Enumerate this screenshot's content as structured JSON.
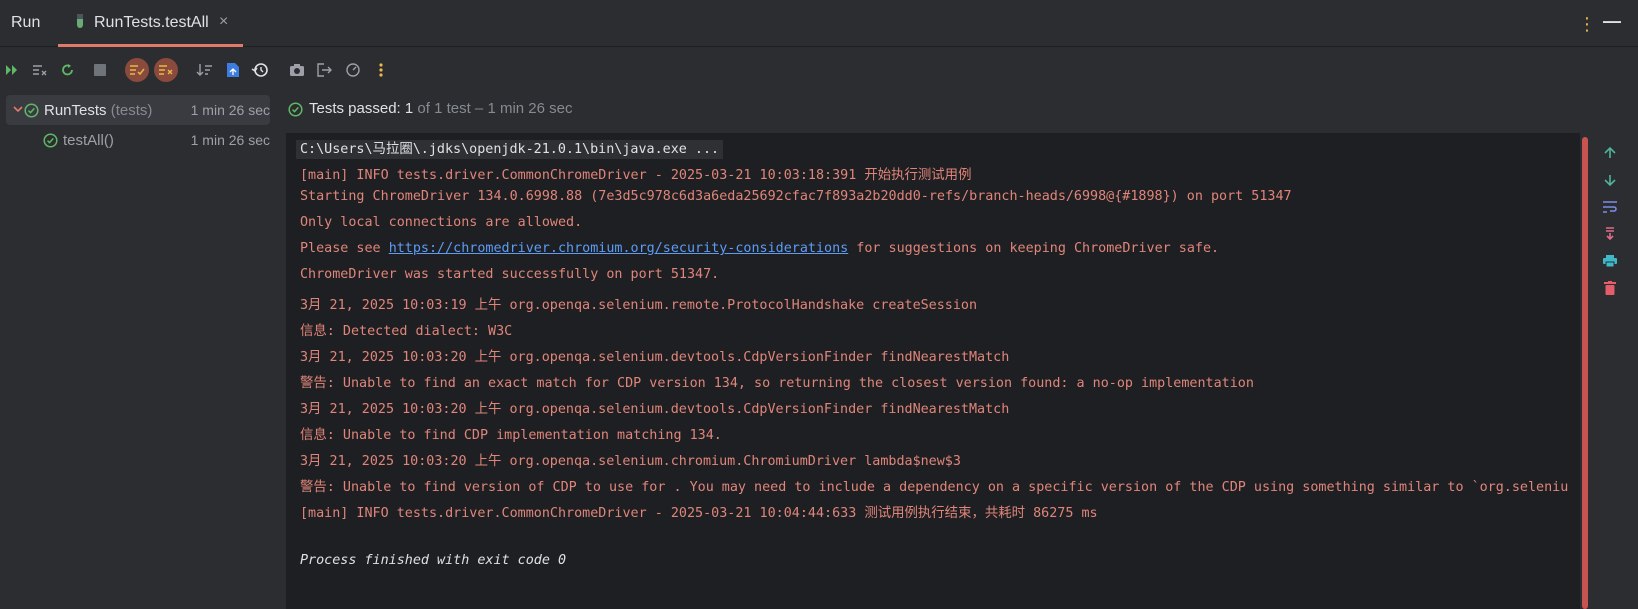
{
  "header": {
    "run_title": "Run",
    "tab_label": "RunTests.testAll",
    "tab_close": "×",
    "more_menu": "⋮",
    "minimize": "—"
  },
  "toolbar": {
    "icons": [
      "rerun-failed-icon",
      "clear-icon",
      "rerun-icon",
      "stop-icon",
      "show-passed-icon",
      "show-ignored-icon",
      "sort-icon",
      "export-icon",
      "history-icon",
      "screenshot-icon",
      "exit-icon",
      "coverage-icon",
      "more-icon"
    ]
  },
  "tree": {
    "root": {
      "name": "RunTests",
      "sub": "(tests)",
      "time": "1 min 26 sec"
    },
    "child": {
      "name": "testAll()",
      "time": "1 min 26 sec"
    }
  },
  "status": {
    "prefix": "Tests passed: ",
    "count": "1",
    "suffix": " of 1 test – 1 min 26 sec"
  },
  "console": {
    "line0": "C:\\Users\\马拉圈\\.jdks\\openjdk-21.0.1\\bin\\java.exe ...",
    "line1": "[main] INFO tests.driver.CommonChromeDriver - 2025-03-21 10:03:18:391 开始执行测试用例",
    "line2": "Starting ChromeDriver 134.0.6998.88 (7e3d5c978c6d3a6eda25692cfac7f893a2b20dd0-refs/branch-heads/6998@{#1898}) on port 51347",
    "line3": "Only local connections are allowed.",
    "line4_pre": "Please see ",
    "line4_link": "https://chromedriver.chromium.org/security-considerations",
    "line4_post": " for suggestions on keeping ChromeDriver safe.",
    "line5": "ChromeDriver was started successfully on port 51347.",
    "line6": "3月 21, 2025 10:03:19 上午 org.openqa.selenium.remote.ProtocolHandshake createSession",
    "line7": "信息: Detected dialect: W3C",
    "line8": "3月 21, 2025 10:03:20 上午 org.openqa.selenium.devtools.CdpVersionFinder findNearestMatch",
    "line9": "警告: Unable to find an exact match for CDP version 134, so returning the closest version found: a no-op implementation",
    "line10": "3月 21, 2025 10:03:20 上午 org.openqa.selenium.devtools.CdpVersionFinder findNearestMatch",
    "line11": "信息: Unable to find CDP implementation matching 134.",
    "line12": "3月 21, 2025 10:03:20 上午 org.openqa.selenium.chromium.ChromiumDriver lambda$new$3",
    "line13": "警告: Unable to find version of CDP to use for . You may need to include a dependency on a specific version of the CDP using something similar to `org.seleniu",
    "line14": "[main] INFO tests.driver.CommonChromeDriver - 2025-03-21 10:04:44:633 测试用例执行结束，共耗时 86275 ms",
    "line15": "Process finished with exit code 0"
  },
  "colors": {
    "accent": "#e07b6a",
    "pass_green": "#5fb865",
    "error_text": "#e0857a",
    "link": "#5c9cf5",
    "scrollbar": "#c75450"
  }
}
